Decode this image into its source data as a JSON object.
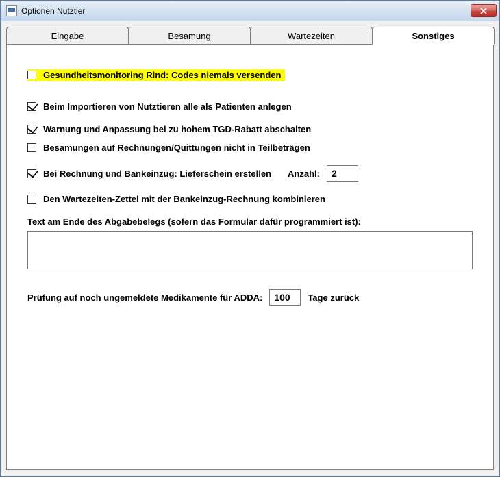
{
  "window": {
    "title": "Optionen Nutztier"
  },
  "tabs": {
    "eingabe": "Eingabe",
    "besamung": "Besamung",
    "wartezeiten": "Wartezeiten",
    "sonstiges": "Sonstiges"
  },
  "options": {
    "gesundheitsmonitoring": {
      "label": "Gesundheitsmonitoring Rind: Codes niemals versenden",
      "checked": false
    },
    "import_patienten": {
      "label": "Beim Importieren von Nutztieren alle als Patienten anlegen",
      "checked": true
    },
    "tgd_rabatt": {
      "label": "Warnung und Anpassung bei zu hohem TGD-Rabatt abschalten",
      "checked": true
    },
    "besamungen_teilbetraege": {
      "label": "Besamungen auf Rechnungen/Quittungen nicht in Teilbeträgen",
      "checked": false
    },
    "lieferschein": {
      "label": "Bei Rechnung und Bankeinzug: Lieferschein erstellen",
      "checked": true,
      "anzahl_label": "Anzahl:",
      "anzahl_value": "2"
    },
    "wartezeiten_zettel": {
      "label": "Den Wartezeiten-Zettel mit der Bankeinzug-Rechnung kombinieren",
      "checked": false
    },
    "abgabebeleg_text": {
      "label": "Text am Ende des Abgabebelegs (sofern das Formular dafür programmiert ist):",
      "value": ""
    },
    "adda": {
      "label_before": "Prüfung auf noch ungemeldete Medikamente für ADDA:",
      "value": "100",
      "label_after": "Tage zurück"
    }
  }
}
